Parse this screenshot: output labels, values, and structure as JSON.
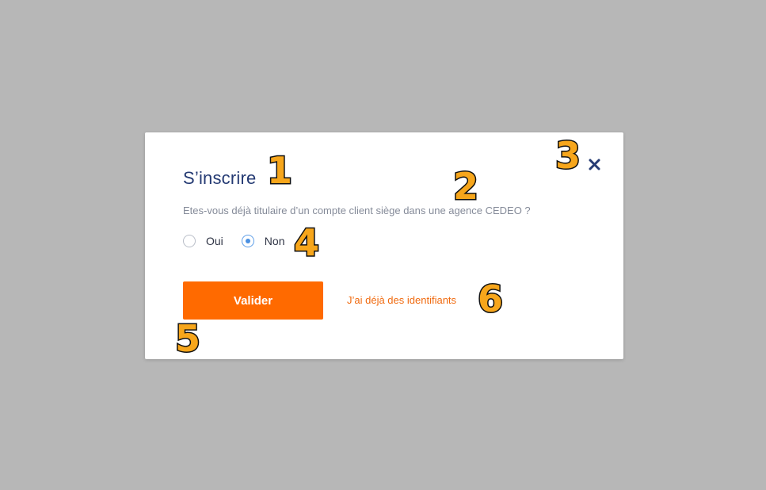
{
  "modal": {
    "title": "S’inscrire",
    "question": "Etes-vous déjà titulaire d’un compte client siège dans une agence CEDEO ?",
    "options": [
      {
        "label": "Oui",
        "selected": false
      },
      {
        "label": "Non",
        "selected": true
      }
    ],
    "validate_label": "Valider",
    "existing_link": "J’ai déjà des identifiants",
    "close_icon": "close-icon",
    "colors": {
      "title": "#243a73",
      "accent": "#ff6a00",
      "radio_selected": "#4a90e2"
    }
  },
  "annotations": [
    "1",
    "2",
    "3",
    "4",
    "5",
    "6"
  ]
}
